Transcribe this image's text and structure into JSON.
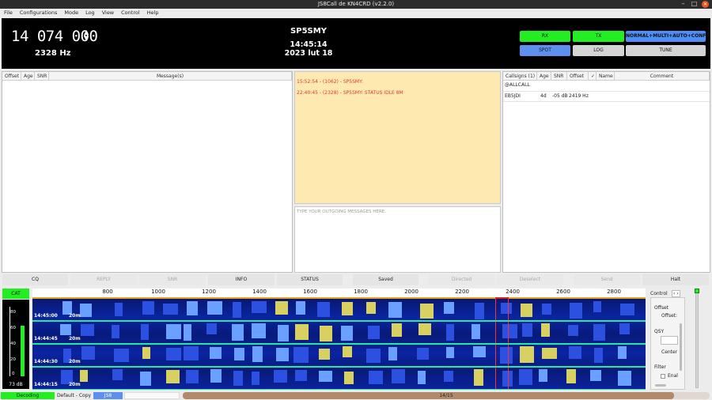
{
  "window": {
    "title": "JS8Call de KN4CRD (v2.2.0)"
  },
  "menu": [
    "File",
    "Configurations",
    "Mode",
    "Log",
    "View",
    "Control",
    "Help"
  ],
  "header": {
    "frequency": "14 074 000",
    "offset": "2328 Hz",
    "callsign": "SP5SMY",
    "time": "14:45:14",
    "date": "2023 lut 18"
  },
  "mode_buttons": {
    "rx": "RX",
    "tx": "TX",
    "mode": "NORMAL+MULTI+AUTO+CONF",
    "spot": "SPOT",
    "log": "LOG",
    "tune": "TUNE"
  },
  "band_activity": {
    "columns": [
      "Offset",
      "Age",
      "SNR",
      "Message(s)"
    ]
  },
  "activity_log": [
    "15:52:54 - (1062) - SP5SMY:",
    "22:40:45 - (2328) - SP5SMY: STATUS IDLE 8M"
  ],
  "outgoing": {
    "placeholder": "TYPE YOUR OUTGOING MESSAGES HERE."
  },
  "callsigns": {
    "columns": [
      "Callsigns (1)",
      "Age",
      "SNR",
      "Offset",
      "✓",
      "Name",
      "Comment"
    ],
    "group": "@ALLCALL",
    "rows": [
      {
        "call": "EB5JDI",
        "age": "4d",
        "snr": "-05 dB",
        "offset": "2419 Hz",
        "check": "",
        "name": "",
        "comment": ""
      }
    ]
  },
  "action_buttons": [
    "CQ",
    "REPLY",
    "SNR",
    "INFO",
    "STATUS",
    "Saved",
    "Directed",
    "Deselect",
    "Send",
    "Halt"
  ],
  "cat": "CAT",
  "meter": {
    "labels": [
      "80",
      "60",
      "40",
      "20",
      "0"
    ],
    "value": "73 dB",
    "level": 0.73
  },
  "waterfall": {
    "ruler": [
      "800",
      "1000",
      "1200",
      "1400",
      "1600",
      "1800",
      "2000",
      "2200",
      "2400",
      "2600",
      "2800"
    ],
    "cycles": [
      {
        "time": "14:45:00",
        "band": "20m"
      },
      {
        "time": "14:44:45",
        "band": "20m"
      },
      {
        "time": "14:44:30",
        "band": "20m"
      },
      {
        "time": "14:44:15",
        "band": "20m"
      }
    ]
  },
  "control_panel": {
    "tab": "Control",
    "tab_arrows": "‹ ›",
    "offset_label": "Offset",
    "offset_field": "Offset:",
    "qsy_label": "QSY",
    "center_button": "Center",
    "filter_label": "Filter",
    "enable_label": "Enal"
  },
  "statusbar": {
    "decoding": "Decoding",
    "config": "Default - Copy",
    "mode": "JS8",
    "progress": "14/15",
    "progress_fraction": 0.933
  },
  "colors": {
    "green": "#22ee22",
    "blue": "#5d8ff0",
    "activity_bg": "#feeab0",
    "activity_text": "#e03a2a",
    "waterfall_bg": "#0a1e85"
  }
}
